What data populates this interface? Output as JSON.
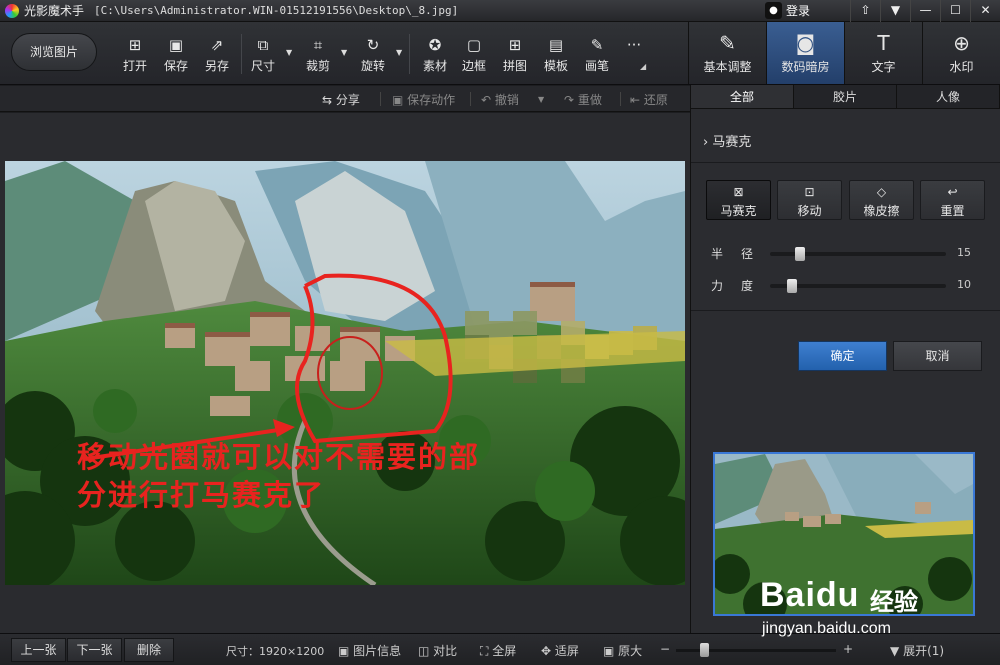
{
  "titlebar": {
    "app_name": "光影魔术手",
    "file_path": "[C:\\Users\\Administrator.WIN-01512191556\\Desktop\\_8.jpg]",
    "login_label": "登录",
    "buttons": [
      "⇧",
      "▼",
      "—",
      "☐",
      "✕"
    ]
  },
  "toolbar": {
    "browse_label": "浏览图片",
    "tools": [
      {
        "label": "打开",
        "icon": "open-icon",
        "glyph": "⊞"
      },
      {
        "label": "保存",
        "icon": "save-icon",
        "glyph": "▣"
      },
      {
        "label": "另存",
        "icon": "save-as-icon",
        "glyph": "⇗"
      },
      {
        "label": "尺寸",
        "icon": "resize-icon",
        "glyph": "⧉"
      },
      {
        "label": "裁剪",
        "icon": "crop-icon",
        "glyph": "⌗"
      },
      {
        "label": "旋转",
        "icon": "rotate-icon",
        "glyph": "↻"
      },
      {
        "label": "素材",
        "icon": "material-icon",
        "glyph": "✪"
      },
      {
        "label": "边框",
        "icon": "border-icon",
        "glyph": "▢"
      },
      {
        "label": "拼图",
        "icon": "collage-icon",
        "glyph": "⊞"
      },
      {
        "label": "模板",
        "icon": "template-icon",
        "glyph": "▤"
      },
      {
        "label": "画笔",
        "icon": "brush-icon",
        "glyph": "✎"
      },
      {
        "label": "",
        "icon": "more-icon",
        "glyph": "···"
      }
    ],
    "modes": [
      {
        "label": "基本调整",
        "icon": "basic-adjust-icon",
        "glyph": "✎"
      },
      {
        "label": "数码暗房",
        "icon": "darkroom-icon",
        "glyph": "◙"
      },
      {
        "label": "文字",
        "icon": "text-icon",
        "glyph": "T"
      },
      {
        "label": "水印",
        "icon": "watermark-icon",
        "glyph": "⊕"
      }
    ]
  },
  "actions": [
    {
      "label": "分享",
      "icon": "share-icon",
      "glyph": "⇆"
    },
    {
      "label": "保存动作",
      "icon": "save-action-icon",
      "glyph": "▣"
    },
    {
      "label": "撤销",
      "icon": "undo-icon",
      "glyph": "↶"
    },
    {
      "label": "重做",
      "icon": "redo-icon",
      "glyph": "↷"
    },
    {
      "label": "还原",
      "icon": "restore-icon",
      "glyph": "⇤"
    }
  ],
  "canvas": {
    "annotation_line1": "移动光圈就可以对不需要的部",
    "annotation_line2": "分进行打马赛克了"
  },
  "panel": {
    "tabs": [
      "全部",
      "胶片",
      "人像"
    ],
    "section_title": "马赛克",
    "section_arrow": "›",
    "tools": [
      {
        "label": "马赛克",
        "icon": "mosaic-icon",
        "glyph": "⊠"
      },
      {
        "label": "移动",
        "icon": "move-icon",
        "glyph": "⊡"
      },
      {
        "label": "橡皮擦",
        "icon": "eraser-icon",
        "glyph": "◇"
      },
      {
        "label": "重置",
        "icon": "reset-icon",
        "glyph": "↩"
      }
    ],
    "sliders": [
      {
        "label": "半径",
        "value": 15
      },
      {
        "label": "力度",
        "value": 10
      }
    ],
    "ok_label": "确定",
    "cancel_label": "取消"
  },
  "statusbar": {
    "prev_label": "上一张",
    "next_label": "下一张",
    "delete_label": "删除",
    "size_text": "尺寸：1920×1200",
    "items": [
      {
        "label": "图片信息",
        "icon": "image-info-icon",
        "glyph": "▣"
      },
      {
        "label": "对比",
        "icon": "compare-icon",
        "glyph": "◫"
      },
      {
        "label": "全屏",
        "icon": "fullscreen-icon",
        "glyph": "⛶"
      },
      {
        "label": "适屏",
        "icon": "fit-screen-icon",
        "glyph": "✥"
      },
      {
        "label": "原大",
        "icon": "original-size-icon",
        "glyph": "▣"
      }
    ],
    "zoom_minus": "−",
    "zoom_plus": "+",
    "expand_label": "展开(1)"
  },
  "watermark": {
    "brand_text": "Baidu",
    "jingyan_text": "经验",
    "url": "jingyan.baidu.com"
  },
  "colors": {
    "accent": "#2f6bc0",
    "annotation_red": "#e8231f"
  }
}
